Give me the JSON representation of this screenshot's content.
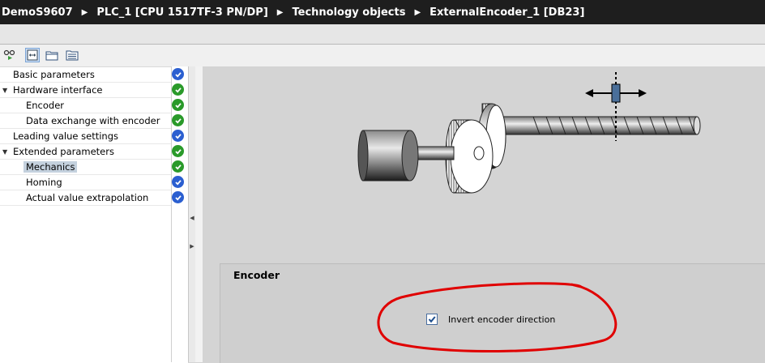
{
  "breadcrumb": [
    "DemoS9607",
    "PLC_1 [CPU 1517TF-3 PN/DP]",
    "Technology objects",
    "ExternalEncoder_1 [DB23]"
  ],
  "nav": {
    "items": [
      {
        "label": "Basic parameters",
        "status": "blue"
      },
      {
        "label": "Hardware interface",
        "status": "green",
        "expanded": true
      },
      {
        "label": "Encoder",
        "status": "green"
      },
      {
        "label": "Data exchange with encoder",
        "status": "green"
      },
      {
        "label": "Leading value settings",
        "status": "blue"
      },
      {
        "label": "Extended parameters",
        "status": "green",
        "expanded": true
      },
      {
        "label": "Mechanics",
        "status": "green",
        "selected": true
      },
      {
        "label": "Homing",
        "status": "blue"
      },
      {
        "label": "Actual value extrapolation",
        "status": "blue"
      }
    ]
  },
  "encoder_section": {
    "title": "Encoder",
    "invert_label": "Invert encoder direction",
    "invert_checked": true
  },
  "colors": {
    "ok": "#2a9a2a",
    "info": "#2b5fd0",
    "annotation": "#e00000",
    "titlebar": "#1e1e1e"
  }
}
